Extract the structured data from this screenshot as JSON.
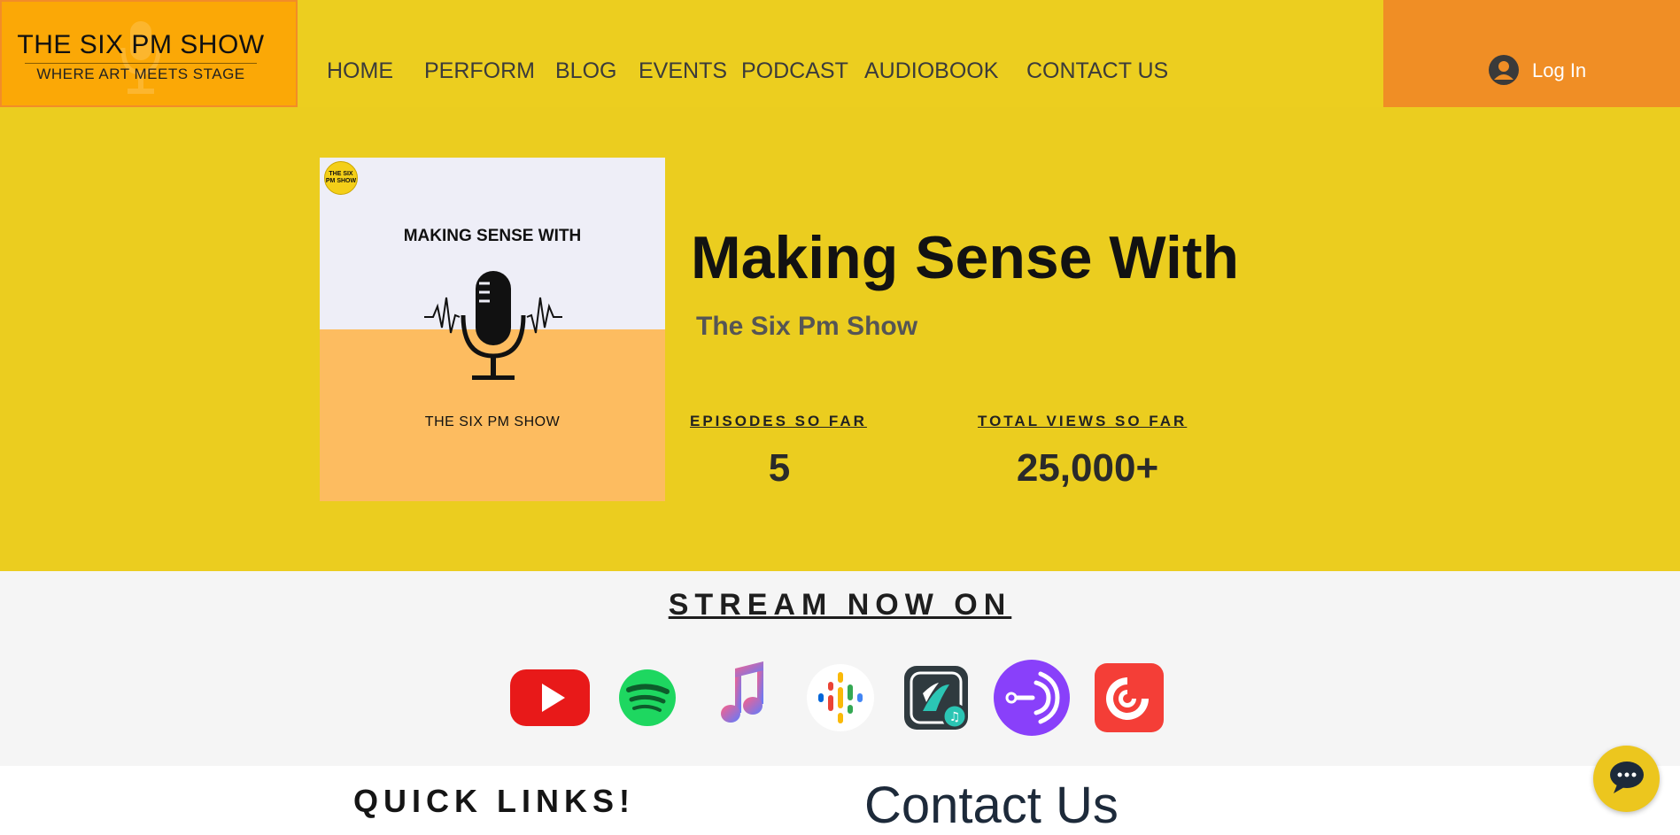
{
  "header": {
    "logo": {
      "title": "THE SIX PM SHOW",
      "tagline": "WHERE ART MEETS STAGE"
    },
    "nav": [
      "HOME",
      "PERFORM",
      "BLOG",
      "EVENTS",
      "PODCAST",
      "AUDIOBOOK",
      "CONTACT US"
    ],
    "login_label": "Log In"
  },
  "hero": {
    "cover": {
      "badge": "THE SIX PM SHOW",
      "title": "MAKING SENSE WITH",
      "show": "THE SIX PM SHOW"
    },
    "title": "Making Sense With",
    "author": "The Six Pm Show",
    "stats": [
      {
        "label": "EPISODES SO FAR",
        "value": "5"
      },
      {
        "label": "TOTAL VIEWS SO FAR",
        "value": "25,000+"
      }
    ]
  },
  "stream": {
    "title": "STREAM NOW ON",
    "platforms": [
      {
        "name": "youtube-icon",
        "color": "#e81919"
      },
      {
        "name": "spotify-icon",
        "color": "#1ed760"
      },
      {
        "name": "apple-music-icon",
        "color": "#8a63f0"
      },
      {
        "name": "google-podcasts-icon",
        "color": "#4285f4"
      },
      {
        "name": "jiosaavn-icon",
        "color": "#2bc5b4"
      },
      {
        "name": "anchor-icon",
        "color": "#8940fa"
      },
      {
        "name": "pocket-casts-icon",
        "color": "#f43e37"
      }
    ]
  },
  "footer": {
    "quick_links": "QUICK LINKS!",
    "contact_title": "Contact Us"
  },
  "colors": {
    "header_bg": "#ecce1f",
    "logo_bg": "#fba806",
    "login_bg": "#f08e25",
    "stream_bg": "#f5f5f5"
  }
}
